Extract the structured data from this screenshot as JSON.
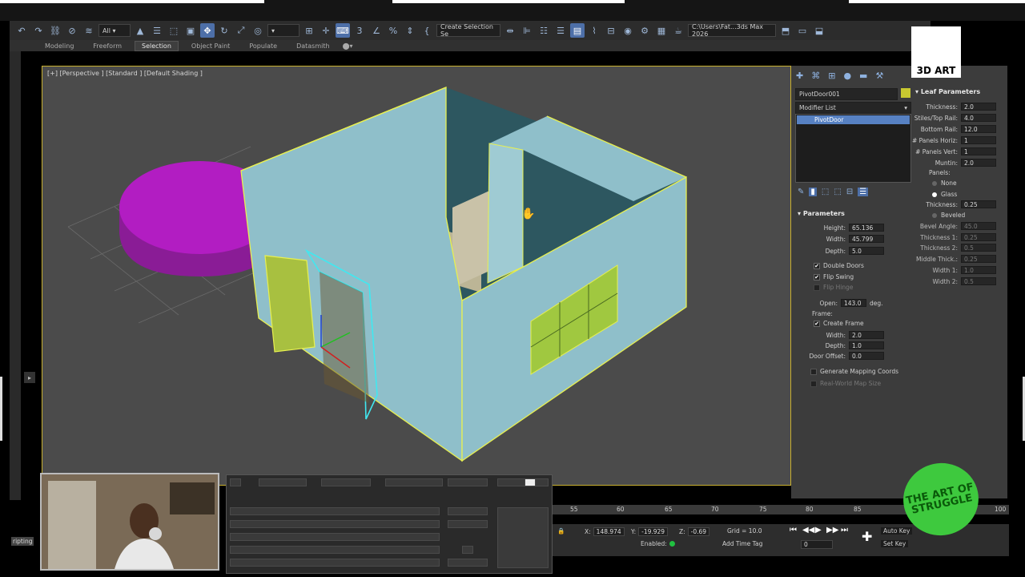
{
  "toolbar": {
    "filter_value": "All",
    "selection_set_placeholder": "Create Selection Se",
    "path_value": "C:\\Users\\Fat...3ds Max 2026"
  },
  "ribbon": {
    "tabs": [
      "Modeling",
      "Freeform",
      "Selection",
      "Object Paint",
      "Populate",
      "Datasmith"
    ],
    "active_tab": "Selection"
  },
  "viewport": {
    "label": "[+] [Perspective ] [Standard ] [Default Shading ]"
  },
  "command_panel": {
    "object_name": "PivotDoor001",
    "modifier_list_label": "Modifier List",
    "stack_item": "PivotDoor",
    "object_color": "#c8c830",
    "parameters": {
      "title": "Parameters",
      "height_label": "Height:",
      "height_value": "65.136",
      "width_label": "Width:",
      "width_value": "45.799",
      "depth_label": "Depth:",
      "depth_value": "5.0",
      "double_doors": "Double Doors",
      "flip_swing": "Flip Swing",
      "flip_hinge": "Flip Hinge",
      "open_label": "Open:",
      "open_value": "143.0",
      "open_unit": "deg.",
      "frame_label": "Frame:",
      "create_frame": "Create Frame",
      "frame_width_label": "Width:",
      "frame_width_value": "2.0",
      "frame_depth_label": "Depth:",
      "frame_depth_value": "1.0",
      "door_offset_label": "Door Offset:",
      "door_offset_value": "0.0",
      "generate_mapping": "Generate Mapping Coords",
      "real_world_map": "Real-World Map Size"
    },
    "leaf_parameters": {
      "title": "Leaf Parameters",
      "thickness_label": "Thickness:",
      "thickness_value": "2.0",
      "stiles_label": "Stiles/Top Rail:",
      "stiles_value": "4.0",
      "bottom_rail_label": "Bottom Rail:",
      "bottom_rail_value": "12.0",
      "panels_horiz_label": "# Panels Horiz:",
      "panels_horiz_value": "1",
      "panels_vert_label": "# Panels Vert:",
      "panels_vert_value": "1",
      "muntin_label": "Muntin:",
      "muntin_value": "2.0",
      "panels_label": "Panels:",
      "none_label": "None",
      "glass_label": "Glass",
      "glass_thickness_label": "Thickness:",
      "glass_thickness_value": "0.25",
      "beveled_label": "Beveled",
      "bevel_angle_label": "Bevel Angle:",
      "bevel_angle_value": "45.0",
      "thickness1_label": "Thickness 1:",
      "thickness1_value": "0.25",
      "thickness2_label": "Thickness 2:",
      "thickness2_value": "0.5",
      "middle_thick_label": "Middle Thick.:",
      "middle_thick_value": "0.25",
      "width1_label": "Width 1:",
      "width1_value": "1.0",
      "width2_label": "Width 2:",
      "width2_value": "0.5"
    }
  },
  "timeline": {
    "ticks": [
      "55",
      "60",
      "65",
      "70",
      "75",
      "80",
      "85",
      "100"
    ]
  },
  "status": {
    "x_label": "X:",
    "x_value": "148.974",
    "y_label": "Y:",
    "y_value": "-19.929",
    "z_label": "Z:",
    "z_value": "-0.69",
    "grid": "Grid = 10.0",
    "enabled": "Enabled:",
    "add_time_tag": "Add Time Tag",
    "auto_key": "Auto Key",
    "set_key": "Set Key",
    "frame_value": "0"
  },
  "branding": {
    "logo_text": "3D ART",
    "channel_logo": "THE ART OF STRUGGLE"
  },
  "misc": {
    "scripting": "ripting"
  }
}
